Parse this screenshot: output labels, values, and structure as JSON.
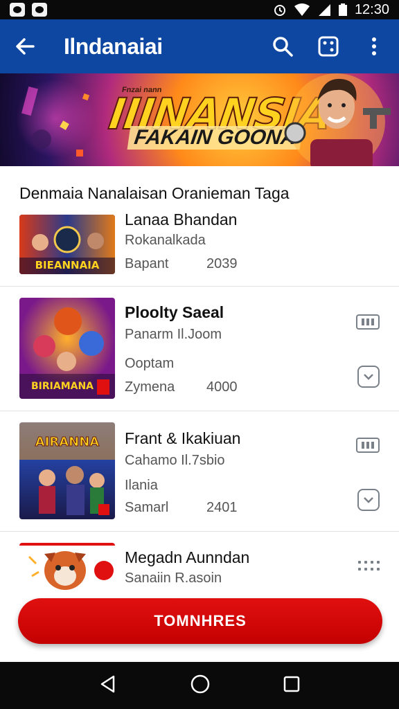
{
  "status_bar": {
    "time": "12:30"
  },
  "app_bar": {
    "title": "Ilndanaiai",
    "back_icon": "back-arrow-icon",
    "actions": [
      "search-icon",
      "dice-icon",
      "more-vert-icon"
    ]
  },
  "banner": {
    "title": "IIINANSIA",
    "subtitle": "FAKAIN GOONA",
    "small_text": "Fnzai nann"
  },
  "section": {
    "heading": "Denmaia Nanalaisan Oranieman Taga"
  },
  "games": [
    {
      "title": "Lanaa Bhandan",
      "line1": "Rokanalkada",
      "label": "Bapant",
      "year": "2039",
      "thumb_text": "BIEANNAIA"
    },
    {
      "title": "Ploolty Saeal",
      "line1": "Panarm Il.Joom",
      "line2": "Ooptam",
      "label": "Zymena",
      "year": "4000",
      "thumb_text": "BIRIAMANA"
    },
    {
      "title": "Frant & Ikakiuan",
      "line1": "Cahamo Il.7sbio",
      "line2": "Ilania",
      "label": "Samarl",
      "year": "2401",
      "thumb_text": "AIRANNA"
    },
    {
      "title": "Megadn Aunndan",
      "line1": "Sanaiin R.asoin"
    }
  ],
  "cta": {
    "label": "TOMNHRES"
  },
  "colors": {
    "app_bar": "#0d47a1",
    "cta": "#d40000"
  }
}
